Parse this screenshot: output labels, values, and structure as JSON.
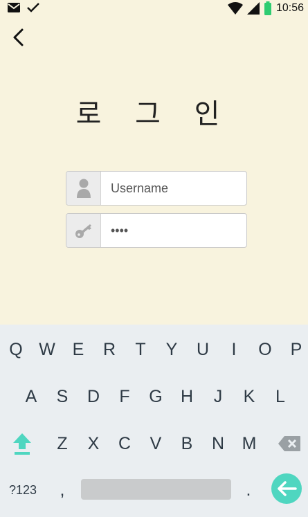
{
  "status_bar": {
    "time": "10:56",
    "icons": [
      "mail-icon",
      "check-icon",
      "wifi-icon",
      "signal-icon",
      "battery-icon"
    ]
  },
  "header": {
    "back_icon": "chevron-left-icon"
  },
  "login": {
    "title": "로 그 인",
    "username": {
      "placeholder": "Username",
      "value": "",
      "icon": "user-icon"
    },
    "password": {
      "value": "••••",
      "icon": "key-icon"
    }
  },
  "keyboard": {
    "row1": [
      "Q",
      "W",
      "E",
      "R",
      "T",
      "Y",
      "U",
      "I",
      "O",
      "P"
    ],
    "row2": [
      "A",
      "S",
      "D",
      "F",
      "G",
      "H",
      "J",
      "K",
      "L"
    ],
    "row3": [
      "Z",
      "X",
      "C",
      "V",
      "B",
      "N",
      "M"
    ],
    "shift_icon": "shift-up-icon",
    "backspace_icon": "backspace-icon",
    "symbols_label": "?123",
    "comma_label": ",",
    "period_label": ".",
    "enter_icon": "enter-arrow-icon"
  },
  "colors": {
    "background": "#f8f3de",
    "keyboard_bg": "#eaeef1",
    "accent": "#4fd6c0",
    "battery": "#2ecc71"
  }
}
